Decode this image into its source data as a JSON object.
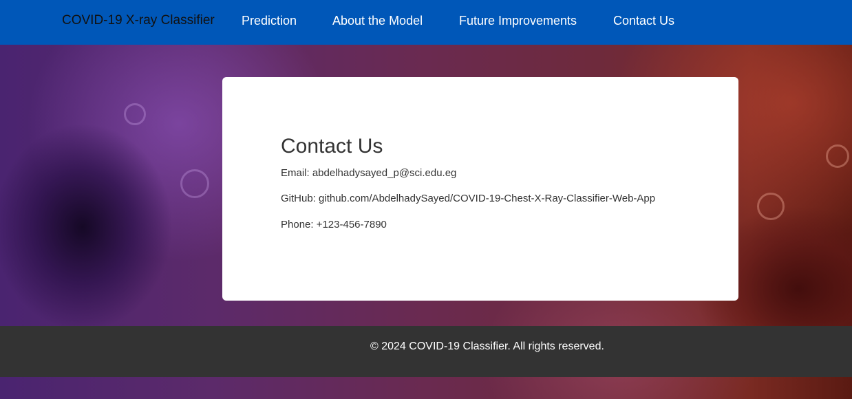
{
  "nav": {
    "brand": "COVID-19 X-ray Classifier",
    "links": [
      "Prediction",
      "About the Model",
      "Future Improvements",
      "Contact Us"
    ]
  },
  "contact": {
    "title": "Contact Us",
    "email": "Email: abdelhadysayed_p@sci.edu.eg",
    "github": "GitHub: github.com/AbdelhadySayed/COVID-19-Chest-X-Ray-Classifier-Web-App",
    "phone": "Phone: +123-456-7890"
  },
  "footer": {
    "copyright": "© 2024 COVID-19 Classifier. All rights reserved."
  },
  "colors": {
    "nav_bg": "#0057b8",
    "footer_bg": "#333333",
    "card_bg": "#ffffff"
  }
}
